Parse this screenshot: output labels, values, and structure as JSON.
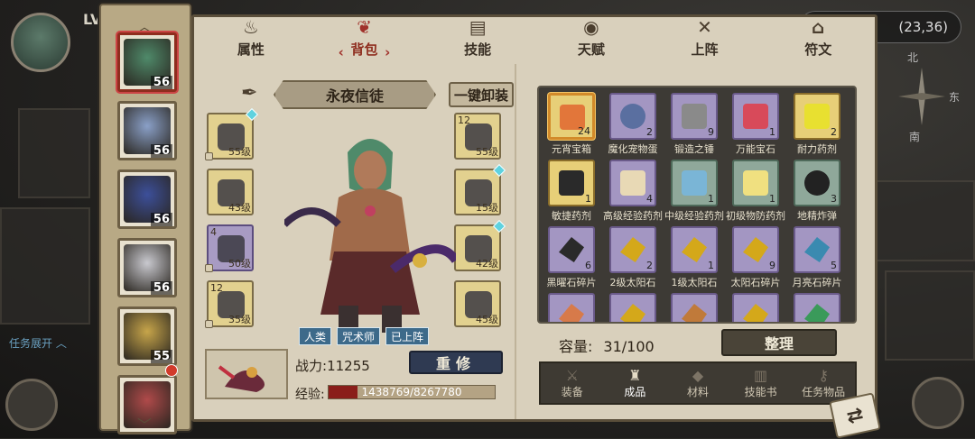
{
  "hud": {
    "level_prefix": "LV",
    "coords": "(23,36)",
    "compass": {
      "north": "北",
      "east": "东",
      "south": "南"
    },
    "task_expand": "任务展开"
  },
  "roster": [
    {
      "level": "56",
      "selected": true,
      "tone": "#4f8a6a"
    },
    {
      "level": "56",
      "selected": false,
      "tone": "#8aa0c8"
    },
    {
      "level": "56",
      "selected": false,
      "tone": "#3c4f9a"
    },
    {
      "level": "56",
      "selected": false,
      "tone": "#c9c9cf"
    },
    {
      "level": "55",
      "selected": false,
      "tone": "#c7a54a"
    },
    {
      "level": "",
      "selected": false,
      "tone": "#b04a4a"
    }
  ],
  "tabs": [
    {
      "label": "属性",
      "icon": "flame-icon"
    },
    {
      "label": "背包",
      "icon": "bag-icon",
      "active": true
    },
    {
      "label": "技能",
      "icon": "book-icon"
    },
    {
      "label": "天赋",
      "icon": "eye-icon"
    },
    {
      "label": "上阵",
      "icon": "crossed-swords-icon"
    },
    {
      "label": "符文",
      "icon": "rune-icon"
    }
  ],
  "character": {
    "name": "永夜信徒",
    "unequip_label": "一键卸装",
    "tags": [
      "人类",
      "咒术师",
      "已上阵"
    ],
    "power_label": "战力:",
    "power_value": "11255",
    "repair_label": "重修",
    "exp_label": "经验:",
    "exp_text": "1438769/8267780",
    "exp_fraction": 0.174
  },
  "equipment_left": [
    {
      "level": "55级",
      "gem": true,
      "lock": true,
      "style": "gold"
    },
    {
      "level": "43级",
      "gem": false,
      "lock": false,
      "style": "gold"
    },
    {
      "level": "50级",
      "gem": false,
      "lock": true,
      "style": "purple",
      "count": "4"
    },
    {
      "level": "35级",
      "gem": false,
      "lock": true,
      "style": "gold",
      "count": "12"
    }
  ],
  "equipment_right": [
    {
      "level": "55级",
      "gem": false,
      "lock": false,
      "style": "gold",
      "count": "12"
    },
    {
      "level": "15级",
      "gem": true,
      "lock": false,
      "style": "gold"
    },
    {
      "level": "42级",
      "gem": true,
      "lock": false,
      "style": "gold"
    },
    {
      "level": "45级",
      "gem": false,
      "lock": false,
      "style": "gold"
    }
  ],
  "inventory": {
    "items": [
      {
        "name": "元宵宝箱",
        "count": "24",
        "style": "gold",
        "selected": true,
        "icon": "chest-icon",
        "color": "#e2763a"
      },
      {
        "name": "魔化宠物蛋",
        "count": "2",
        "style": "purple",
        "icon": "egg-icon",
        "color": "#5a6fa0"
      },
      {
        "name": "锻造之锤",
        "count": "9",
        "style": "purple",
        "icon": "hammer-icon",
        "color": "#8a8a8a"
      },
      {
        "name": "万能宝石",
        "count": "1",
        "style": "purple",
        "icon": "crystal-icon",
        "color": "#d84a5a"
      },
      {
        "name": "耐力药剂",
        "count": "2",
        "style": "gold",
        "icon": "potion-icon",
        "color": "#e8e030"
      },
      {
        "name": "敏捷药剂",
        "count": "1",
        "style": "gold",
        "icon": "potion-icon",
        "color": "#2a2a2a"
      },
      {
        "name": "高级经验药剂",
        "count": "4",
        "style": "purple",
        "icon": "flask-icon",
        "color": "#e8d9b5"
      },
      {
        "name": "中级经验药剂",
        "count": "1",
        "style": "green",
        "icon": "flask-icon",
        "color": "#7ab5d6"
      },
      {
        "name": "初级物防药剂",
        "count": "1",
        "style": "green",
        "icon": "vial-icon",
        "color": "#f0e080"
      },
      {
        "name": "地精炸弹",
        "count": "3",
        "style": "green",
        "icon": "bomb-icon",
        "color": "#222"
      },
      {
        "name": "黑曜石碎片",
        "count": "6",
        "style": "purple",
        "icon": "shard-icon",
        "color": "#2a2a2a"
      },
      {
        "name": "2级太阳石",
        "count": "2",
        "style": "purple",
        "icon": "shard-icon",
        "color": "#d4a81a"
      },
      {
        "name": "1级太阳石",
        "count": "1",
        "style": "purple",
        "icon": "shard-icon",
        "color": "#d4a81a"
      },
      {
        "name": "太阳石碎片",
        "count": "9",
        "style": "purple",
        "icon": "shard-icon",
        "color": "#d4a81a"
      },
      {
        "name": "月亮石碎片",
        "count": "5",
        "style": "purple",
        "icon": "shard-icon",
        "color": "#3a8ab0"
      }
    ],
    "partial_row_colors": [
      "#d77a4a",
      "#d4a81a",
      "#c07a3a",
      "#d4a81a",
      "#3a9a5a"
    ],
    "capacity_label": "容量:",
    "capacity_value": "31/100",
    "sort_label": "整理"
  },
  "categories": [
    {
      "label": "装备",
      "icon": "sword-icon"
    },
    {
      "label": "成品",
      "icon": "pouch-icon",
      "active": true
    },
    {
      "label": "材料",
      "icon": "ore-icon"
    },
    {
      "label": "技能书",
      "icon": "scroll-icon"
    },
    {
      "label": "任务物品",
      "icon": "key-icon"
    }
  ]
}
